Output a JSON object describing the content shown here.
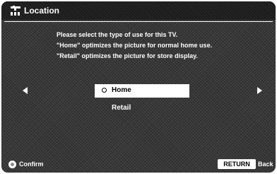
{
  "header": {
    "title": "Location",
    "icon": "settings-toolbox-icon"
  },
  "instructions": {
    "line1": "Please select the type of use for this TV.",
    "line2": "\"Home\" optimizes the picture for normal home use.",
    "line3": "\"Retail\" optimizes the picture for store display."
  },
  "options": [
    {
      "label": "Home",
      "selected": true
    },
    {
      "label": "Retail",
      "selected": false
    }
  ],
  "footer": {
    "confirm_label": "Confirm",
    "return_label": "RETURN",
    "back_label": "Back"
  },
  "colors": {
    "background": "#383838",
    "title_bar": "#1c1c1c",
    "text": "#ffffff",
    "highlight": "#ffffff"
  }
}
